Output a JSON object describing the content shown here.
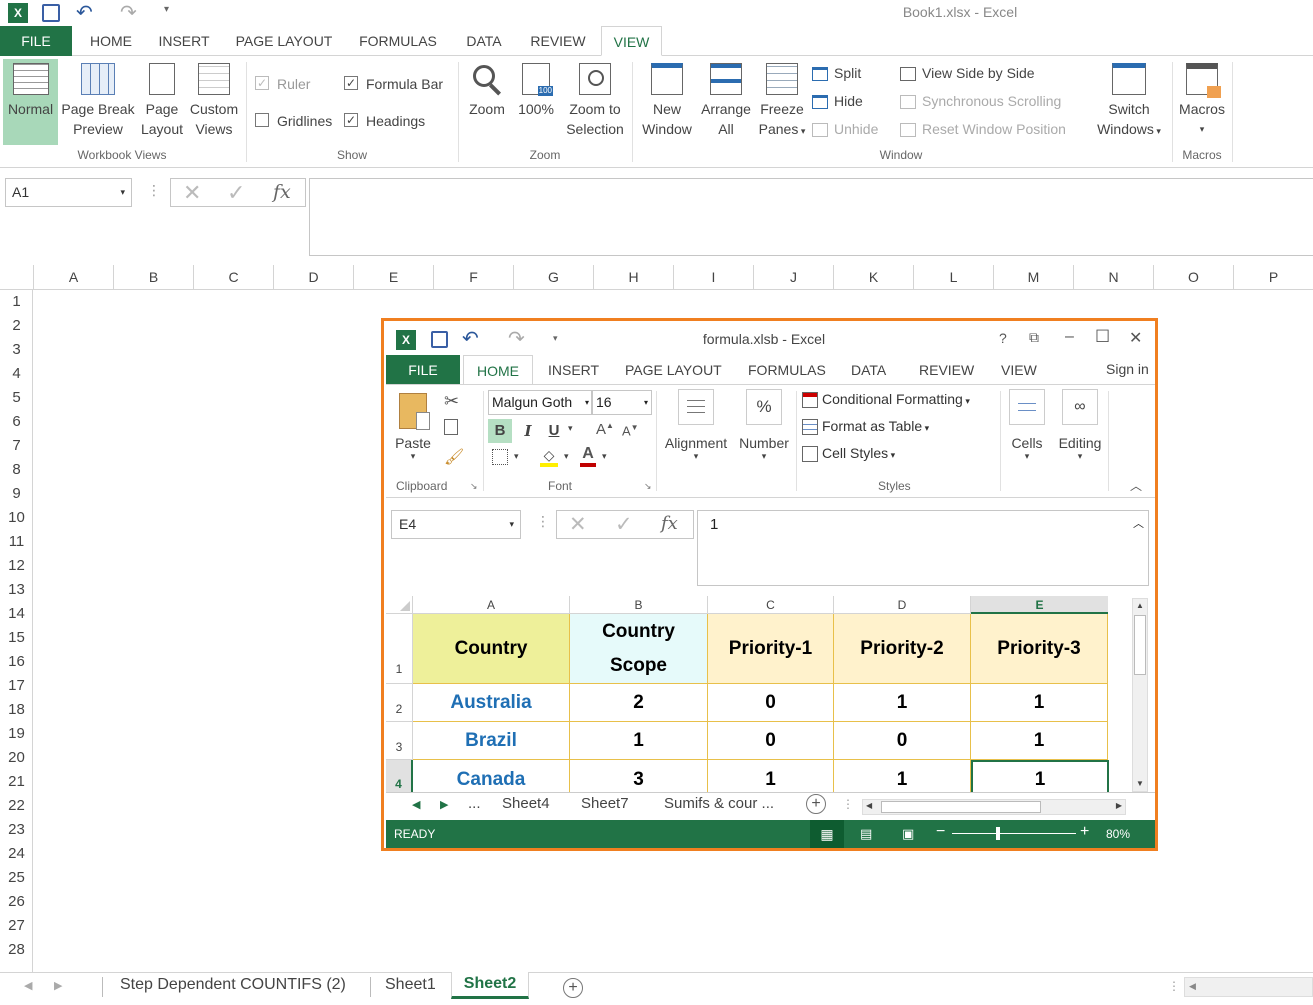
{
  "window": {
    "title": "Book1.xlsx - Excel"
  },
  "tabs": [
    "FILE",
    "HOME",
    "INSERT",
    "PAGE LAYOUT",
    "FORMULAS",
    "DATA",
    "REVIEW",
    "VIEW"
  ],
  "ribbon": {
    "workbook_views": {
      "normal": "Normal",
      "page_break_1": "Page Break",
      "page_break_2": "Preview",
      "page_layout_1": "Page",
      "page_layout_2": "Layout",
      "custom_1": "Custom",
      "custom_2": "Views",
      "label": "Workbook Views"
    },
    "show": {
      "ruler": "Ruler",
      "formula_bar": "Formula Bar",
      "gridlines": "Gridlines",
      "headings": "Headings",
      "label": "Show"
    },
    "zoom": {
      "zoom": "Zoom",
      "hundred": "100%",
      "zoom_sel_1": "Zoom to",
      "zoom_sel_2": "Selection",
      "label": "Zoom",
      "badge": "100"
    },
    "window": {
      "new_1": "New",
      "new_2": "Window",
      "arrange_1": "Arrange",
      "arrange_2": "All",
      "freeze_1": "Freeze",
      "freeze_2": "Panes",
      "split": "Split",
      "hide": "Hide",
      "unhide": "Unhide",
      "side": "View Side by Side",
      "sync": "Synchronous Scrolling",
      "reset": "Reset Window Position",
      "switch_1": "Switch",
      "switch_2": "Windows",
      "label": "Window"
    },
    "macros": {
      "macros": "Macros",
      "label": "Macros"
    }
  },
  "formula_bar": {
    "name_box": "A1",
    "fx": "fx"
  },
  "columns": [
    "A",
    "B",
    "C",
    "D",
    "E",
    "F",
    "G",
    "H",
    "I",
    "J",
    "K",
    "L",
    "M",
    "N",
    "O",
    "P"
  ],
  "rows": [
    "1",
    "2",
    "3",
    "4",
    "5",
    "6",
    "7",
    "8",
    "9",
    "10",
    "11",
    "12",
    "13",
    "14",
    "15",
    "16",
    "17",
    "18",
    "19",
    "20",
    "21",
    "22",
    "23",
    "24",
    "25",
    "26",
    "27",
    "28"
  ],
  "sheets": [
    "Step Dependent COUNTIFS (2)",
    "Sheet1",
    "Sheet2"
  ],
  "active_sheet": "Sheet2",
  "embedded": {
    "title": "formula.xlsb - Excel",
    "tabs": [
      "FILE",
      "HOME",
      "INSERT",
      "PAGE LAYOUT",
      "FORMULAS",
      "DATA",
      "REVIEW",
      "VIEW"
    ],
    "sign_in": "Sign in",
    "title_buttons": [
      "?",
      "⧉",
      "–",
      "☐",
      "✕"
    ],
    "font_name": "Malgun Goth",
    "font_size": "16",
    "bold": "B",
    "italic": "I",
    "underline": "U",
    "paste": "Paste",
    "clipboard": "Clipboard",
    "font": "Font",
    "alignment": "Alignment",
    "number": "Number",
    "percent": "%",
    "cond_format": "Conditional Formatting",
    "format_table": "Format as Table",
    "cell_styles": "Cell Styles",
    "styles": "Styles",
    "cells": "Cells",
    "editing": "Editing",
    "name_box": "E4",
    "formula_value": "1",
    "fx": "fx",
    "col_headers": [
      "A",
      "B",
      "C",
      "D",
      "E"
    ],
    "row_headers": [
      "1",
      "2",
      "3",
      "4"
    ],
    "header_row": [
      "Country",
      "Country Scope",
      "Priority-1",
      "Priority-2",
      "Priority-3"
    ],
    "data_rows": [
      [
        "Australia",
        "2",
        "0",
        "1",
        "1"
      ],
      [
        "Brazil",
        "1",
        "0",
        "0",
        "1"
      ],
      [
        "Canada",
        "3",
        "1",
        "1",
        "1"
      ]
    ],
    "sheet_tabs": [
      "...",
      "Sheet4",
      "Sheet7",
      "Sumifs & cour ..."
    ],
    "status": "READY",
    "zoom": "80%"
  }
}
